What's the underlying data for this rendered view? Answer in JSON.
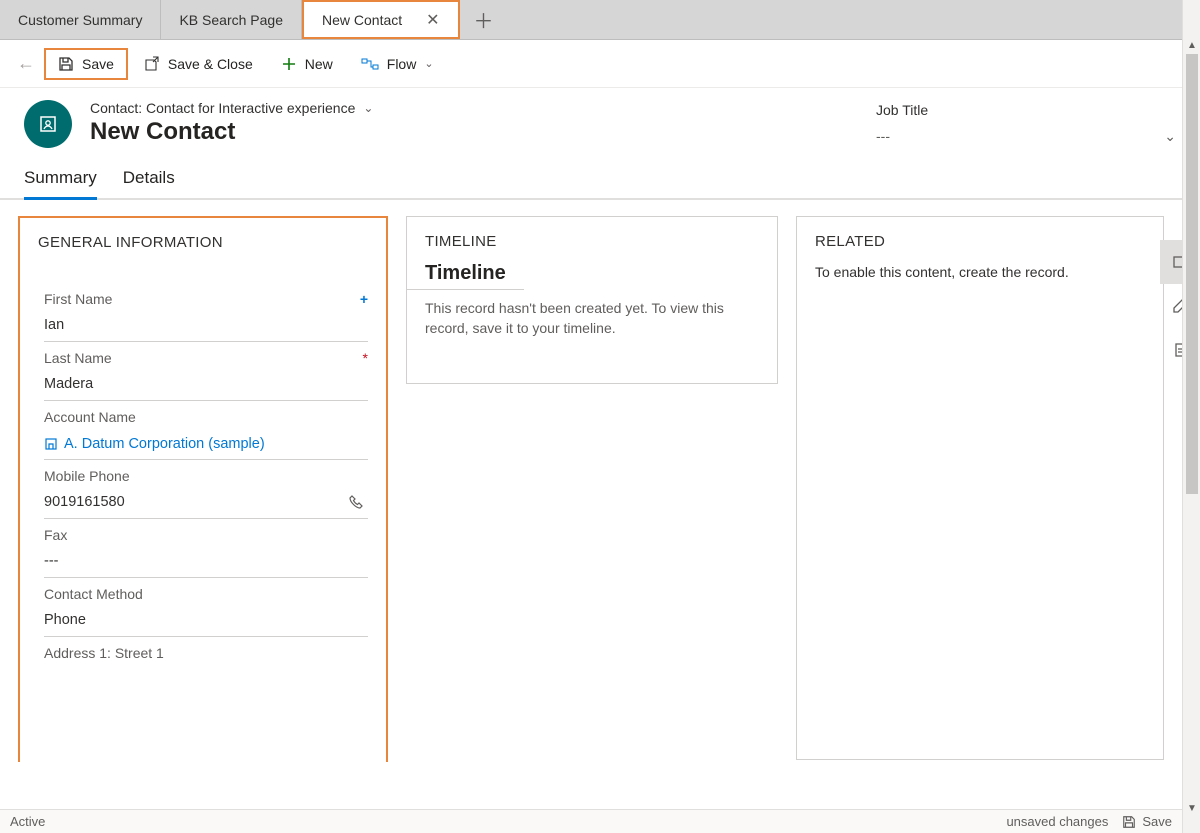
{
  "tabs": [
    {
      "label": "Customer Summary",
      "active": false
    },
    {
      "label": "KB Search Page",
      "active": false
    },
    {
      "label": "New Contact",
      "active": true
    }
  ],
  "commands": {
    "save": "Save",
    "saveClose": "Save & Close",
    "new": "New",
    "flow": "Flow"
  },
  "header": {
    "formSelector": "Contact: Contact for Interactive experience",
    "title": "New Contact",
    "extraLabel": "Job Title",
    "extraValue": "---"
  },
  "sectionTabs": [
    {
      "label": "Summary",
      "active": true
    },
    {
      "label": "Details",
      "active": false
    }
  ],
  "general": {
    "heading": "GENERAL INFORMATION",
    "fields": {
      "firstName": {
        "label": "First Name",
        "value": "Ian",
        "recommended": true
      },
      "lastName": {
        "label": "Last Name",
        "value": "Madera",
        "required": true
      },
      "accountName": {
        "label": "Account Name",
        "value": "A. Datum Corporation (sample)"
      },
      "mobilePhone": {
        "label": "Mobile Phone",
        "value": "9019161580"
      },
      "fax": {
        "label": "Fax",
        "value": "---"
      },
      "contactMethod": {
        "label": "Contact Method",
        "value": "Phone"
      },
      "address1": {
        "label": "Address 1: Street 1",
        "value": ""
      }
    }
  },
  "timeline": {
    "heading": "TIMELINE",
    "title": "Timeline",
    "message": "This record hasn't been created yet.  To view this record, save it to your timeline."
  },
  "related": {
    "heading": "RELATED",
    "message": "To enable this content, create the record."
  },
  "status": {
    "state": "Active",
    "unsaved": "unsaved changes",
    "saveLabel": "Save"
  }
}
